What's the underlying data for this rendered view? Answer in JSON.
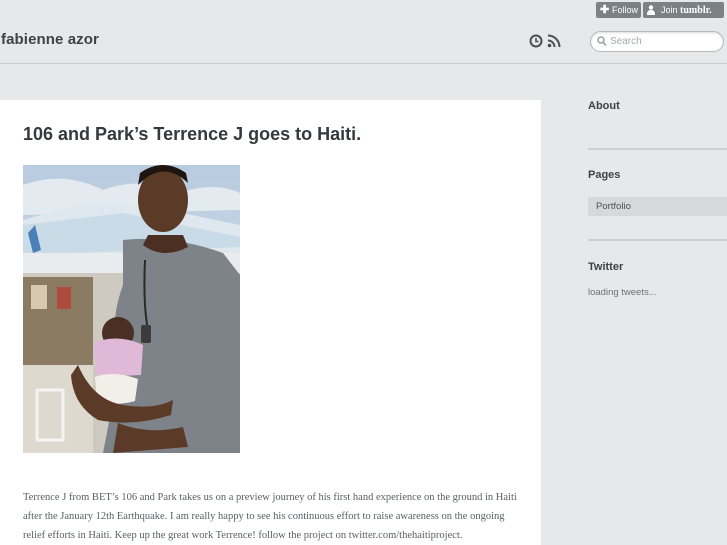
{
  "header": {
    "blog_title": "fabienne azor",
    "follow_label": "Follow",
    "join_label": "Join",
    "join_brand": "tumblr.",
    "search": {
      "placeholder": "Search"
    },
    "icons": [
      "clock-icon",
      "rss-icon",
      "search-icon",
      "plus-icon",
      "person-icon"
    ]
  },
  "post": {
    "title": "106 and Park’s Terrence J goes to Haiti.",
    "body": "Terrence J from BET’s 106 and Park takes us on a preview journey of his first hand experience on the ground in Haiti after the January 12th Earthquake. I am really happy to see his continuous effort to raise awareness on the ongoing relief efforts in Haiti. Keep up the great work Terrence! follow the project on twitter.com/thehaitiproject."
  },
  "sidebar": {
    "about_heading": "About",
    "pages_heading": "Pages",
    "pages": [
      {
        "label": "Portfolio"
      }
    ],
    "twitter_heading": "Twitter",
    "twitter_status": "loading tweets..."
  },
  "colors": {
    "background": "#e6e8e9",
    "content_bg": "#ffffff",
    "title_text": "#333a3e",
    "button_bg": "#7c8284"
  }
}
